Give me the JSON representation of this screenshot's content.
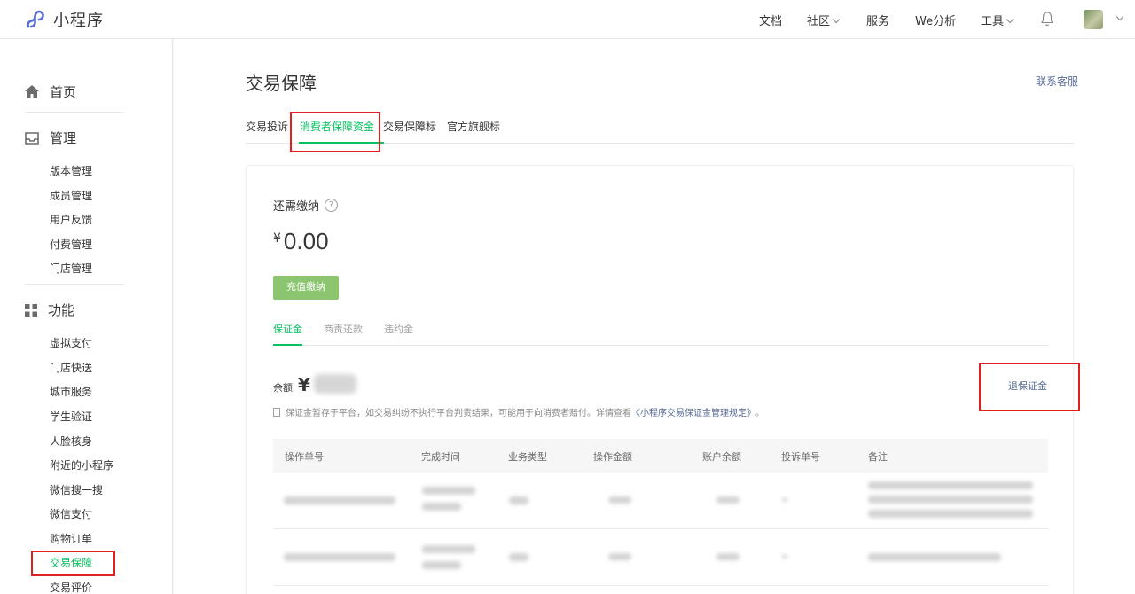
{
  "app": {
    "name": "小程序"
  },
  "topnav": {
    "docs": "文档",
    "community": "社区",
    "service": "服务",
    "analytics": "We分析",
    "tools": "工具"
  },
  "sidebar": {
    "home": "首页",
    "manage": {
      "title": "管理",
      "items": [
        "版本管理",
        "成员管理",
        "用户反馈",
        "付费管理",
        "门店管理"
      ]
    },
    "features": {
      "title": "功能",
      "items": [
        "虚拟支付",
        "门店快送",
        "城市服务",
        "学生验证",
        "人脸核身",
        "附近的小程序",
        "微信搜一搜",
        "微信支付",
        "购物订单",
        "交易保障",
        "交易评价"
      ]
    }
  },
  "page": {
    "title": "交易保障",
    "contact": "联系客服",
    "tabs": [
      "交易投诉",
      "消费者保障资金",
      "交易保障标",
      "官方旗舰标"
    ],
    "need_pay_label": "还需缴纳",
    "help_glyph": "?",
    "currency": "¥",
    "amount": "0.00",
    "recharge_button": "充值缴纳",
    "subtabs": [
      "保证金",
      "商责还款",
      "违约金"
    ],
    "balance_label": "余额",
    "balance_currency": "¥",
    "withdraw_link": "退保证金",
    "notice_text": "保证金暂存于平台，如交易纠纷不执行平台判责结果，可能用于向消费者赔付。详情查看",
    "notice_link": "《小程序交易保证金管理规定》",
    "notice_end": "。",
    "table_headers": [
      "操作单号",
      "完成时间",
      "业务类型",
      "操作金额",
      "账户余额",
      "投诉单号",
      "备注"
    ]
  },
  "colors": {
    "accent_green": "#07c160",
    "button_green": "#8bc56f",
    "link_blue": "#576b95",
    "highlight_red": "#e02020"
  }
}
